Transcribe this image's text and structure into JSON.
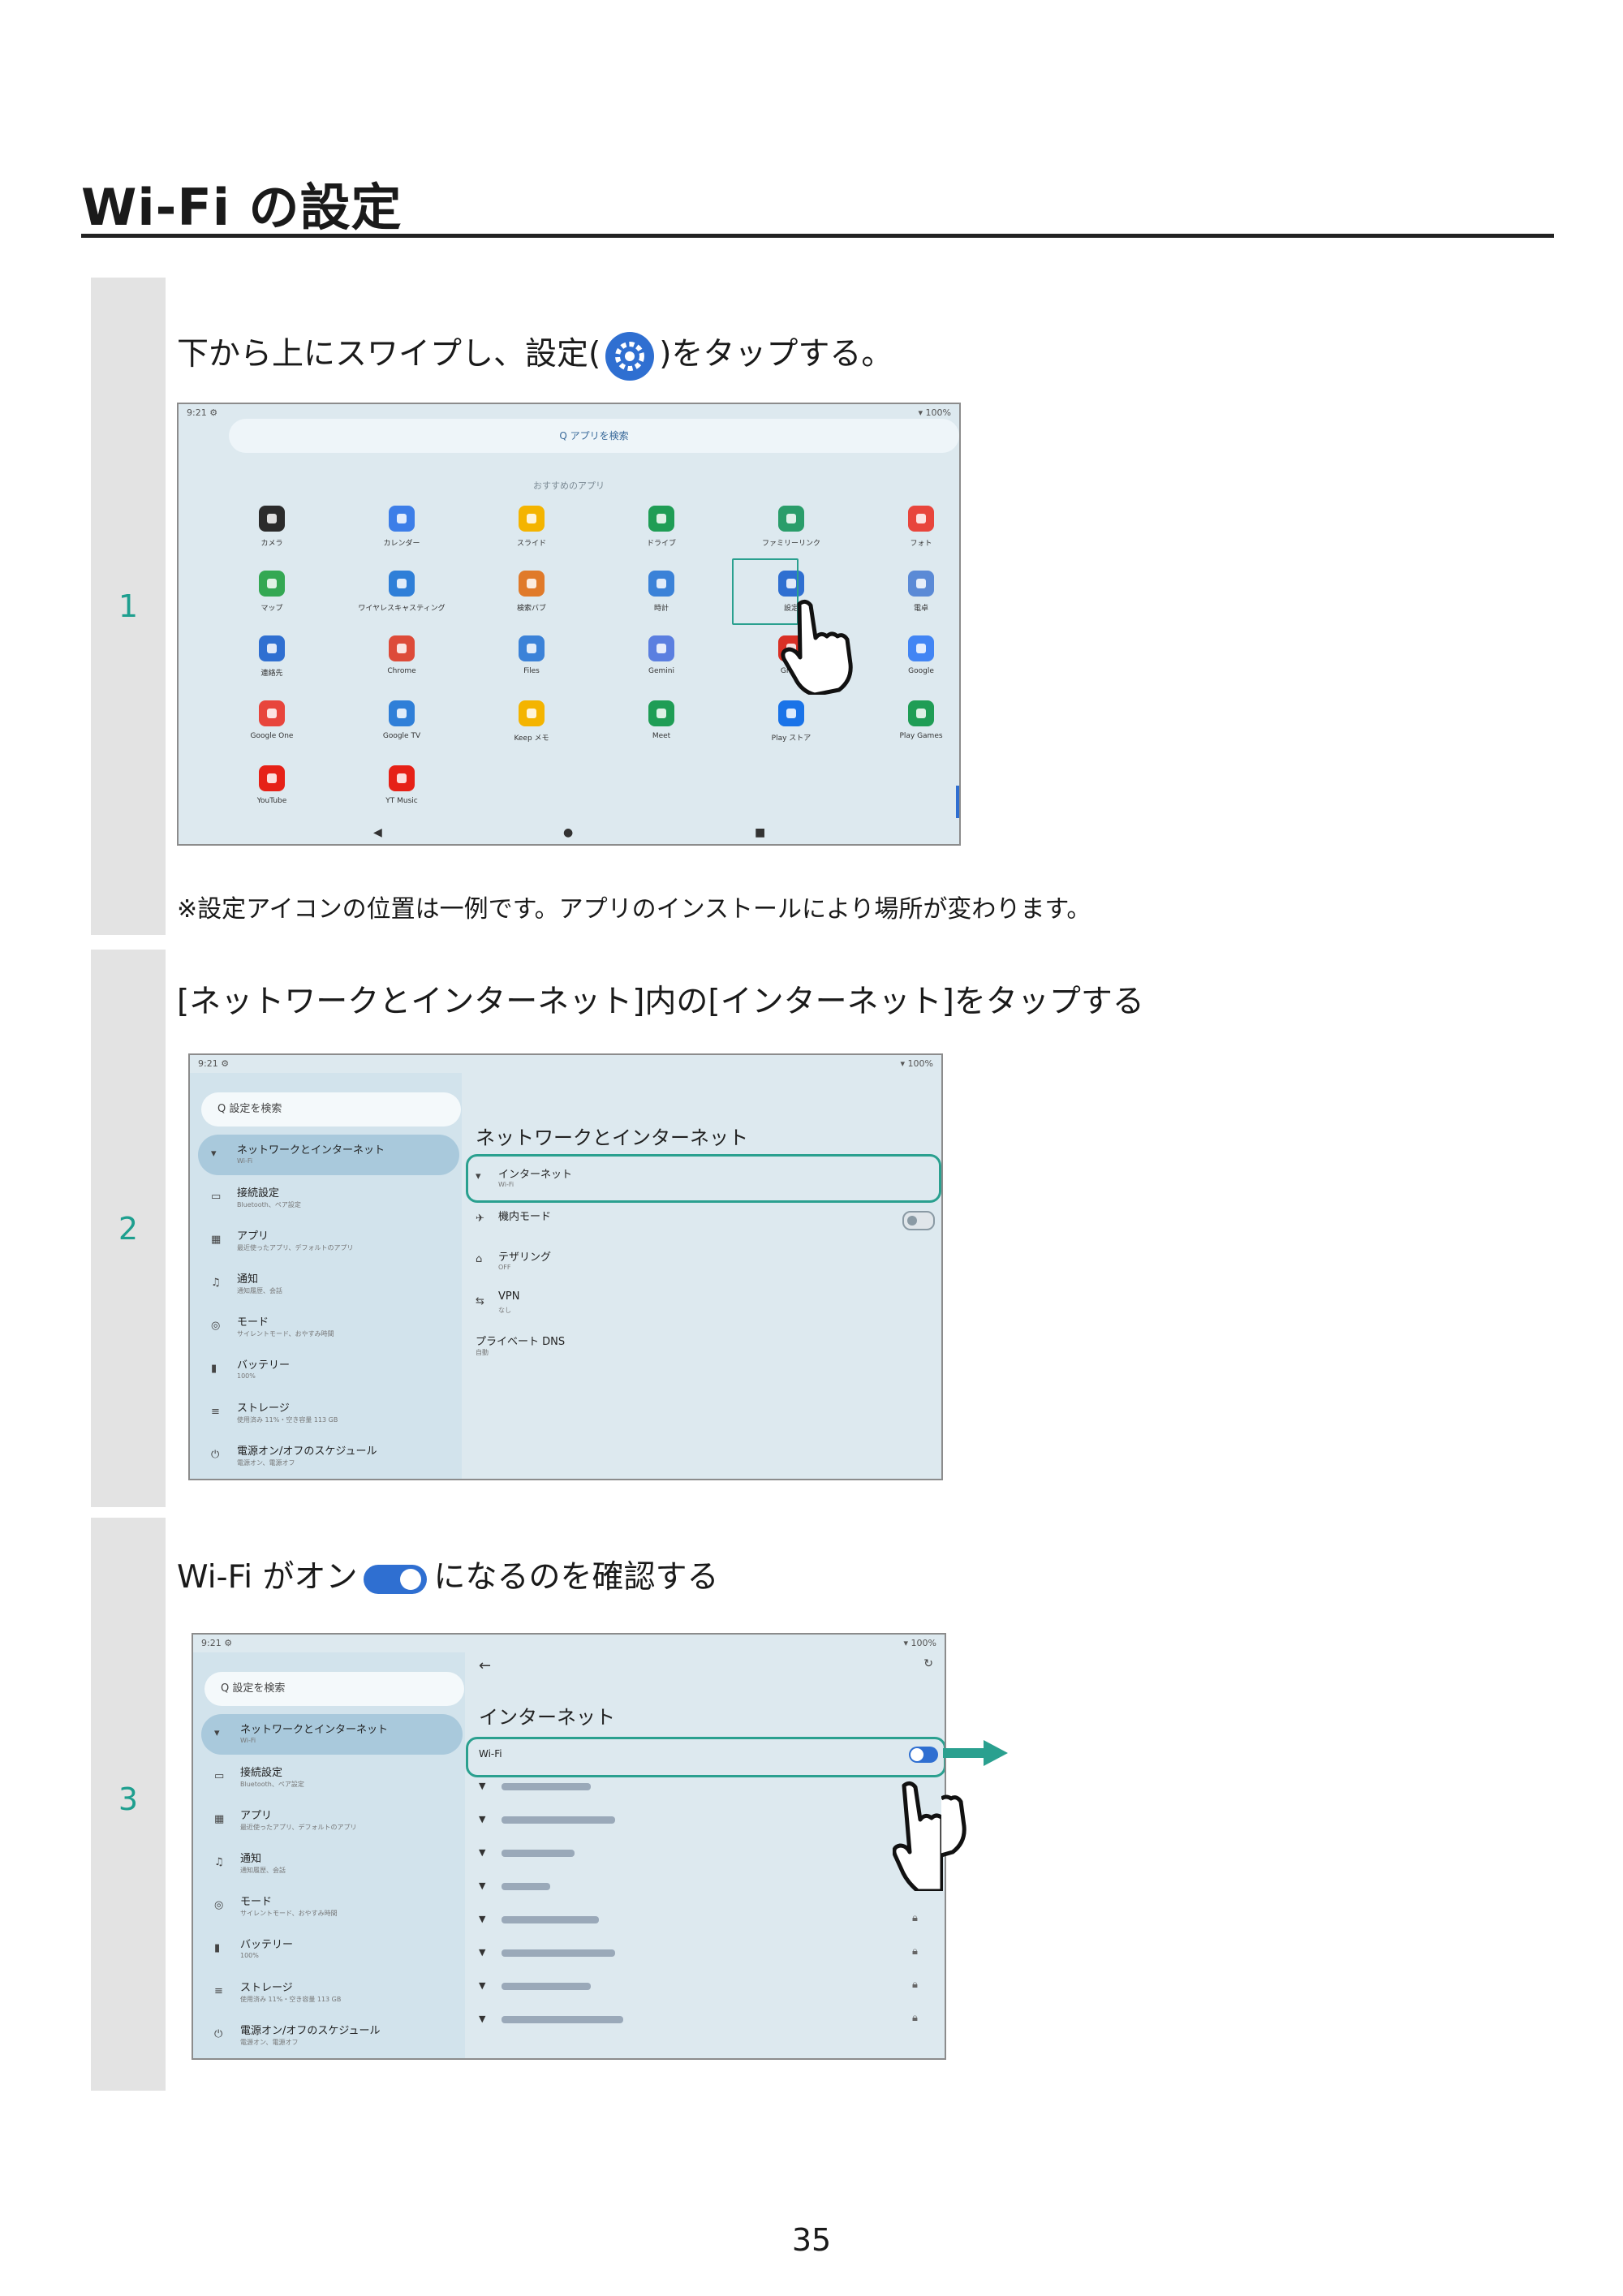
{
  "page": {
    "title": "Wi-Fi の設定",
    "page_number": "35"
  },
  "steps": [
    {
      "number": "1",
      "instruction_before": "下から上にスワイプし、設定(",
      "instruction_icon": "gear-icon",
      "instruction_after": ")をタップする。",
      "note": "※設定アイコンの位置は一例です。アプリのインストールにより場所が変わります。"
    },
    {
      "number": "2",
      "instruction": "[ネットワークとインターネット]内の[インターネット]をタップする"
    },
    {
      "number": "3",
      "instruction_before": "Wi-Fi がオン",
      "instruction_icon": "toggle-on-icon",
      "instruction_after": "になるのを確認する"
    }
  ],
  "home_screen": {
    "status_left": "9:21 ⚙",
    "status_right": "▾ 100%",
    "search_placeholder": "Q アプリを検索",
    "section_label": "おすすめのアプリ",
    "apps": [
      {
        "label": "カメラ",
        "color": "#2b2b2b",
        "icon": "camera-icon"
      },
      {
        "label": "カレンダー",
        "color": "#3d7ee8",
        "icon": "calendar-icon"
      },
      {
        "label": "スライド",
        "color": "#f4b400",
        "icon": "slides-icon"
      },
      {
        "label": "ドライブ",
        "color": "#1f9d55",
        "icon": "drive-icon"
      },
      {
        "label": "ファミリーリンク",
        "color": "#2a9d6a",
        "icon": "family-link-icon"
      },
      {
        "label": "フォト",
        "color": "#e8453c",
        "icon": "photos-icon"
      },
      {
        "label": "マップ",
        "color": "#34a853",
        "icon": "maps-icon"
      },
      {
        "label": "ワイヤレスキャスティング",
        "color": "#2f7fd8",
        "icon": "cast-icon"
      },
      {
        "label": "検索バブ",
        "color": "#e07a2a",
        "icon": "bubble-icon"
      },
      {
        "label": "時計",
        "color": "#3b82d8",
        "icon": "clock-icon"
      },
      {
        "label": "設定",
        "color": "#2f6fd1",
        "icon": "settings-icon"
      },
      {
        "label": "電卓",
        "color": "#5b8ad6",
        "icon": "calculator-icon"
      },
      {
        "label": "連絡先",
        "color": "#2f6fd1",
        "icon": "contacts-icon"
      },
      {
        "label": "Chrome",
        "color": "#dd4b39",
        "icon": "chrome-icon"
      },
      {
        "label": "Files",
        "color": "#3b82d8",
        "icon": "files-icon"
      },
      {
        "label": "Gemini",
        "color": "#5b7fe0",
        "icon": "gemini-icon"
      },
      {
        "label": "Gmail",
        "color": "#d93025",
        "icon": "gmail-icon"
      },
      {
        "label": "Google",
        "color": "#4285f4",
        "icon": "google-icon"
      },
      {
        "label": "Google One",
        "color": "#e8453c",
        "icon": "google-one-icon"
      },
      {
        "label": "Google TV",
        "color": "#2f7fd8",
        "icon": "google-tv-icon"
      },
      {
        "label": "Keep メモ",
        "color": "#f4b400",
        "icon": "keep-icon"
      },
      {
        "label": "Meet",
        "color": "#1f9d55",
        "icon": "meet-icon"
      },
      {
        "label": "Play ストア",
        "color": "#1a73e8",
        "icon": "play-store-icon"
      },
      {
        "label": "Play Games",
        "color": "#1f9d55",
        "icon": "play-games-icon"
      },
      {
        "label": "YouTube",
        "color": "#e62117",
        "icon": "youtube-icon"
      },
      {
        "label": "YT Music",
        "color": "#e62117",
        "icon": "yt-music-icon"
      }
    ]
  },
  "settings_sidebar": {
    "search": "Q 設定を検索",
    "items": [
      {
        "title": "ネットワークとインターネット",
        "subtitle": "Wi-Fi",
        "icon": "wifi-icon"
      },
      {
        "title": "接続設定",
        "subtitle": "Bluetooth、ペア設定",
        "icon": "devices-icon"
      },
      {
        "title": "アプリ",
        "subtitle": "最近使ったアプリ、デフォルトのアプリ",
        "icon": "apps-icon"
      },
      {
        "title": "通知",
        "subtitle": "通知履歴、会話",
        "icon": "bell-icon"
      },
      {
        "title": "モード",
        "subtitle": "サイレントモード、おやすみ時間",
        "icon": "mode-icon"
      },
      {
        "title": "バッテリー",
        "subtitle": "100%",
        "icon": "battery-icon"
      },
      {
        "title": "ストレージ",
        "subtitle": "使用済み 11%・空き容量 113 GB",
        "icon": "storage-icon"
      },
      {
        "title": "電源オン/オフのスケジュール",
        "subtitle": "電源オン、電源オフ",
        "icon": "power-icon"
      }
    ]
  },
  "network_panel": {
    "title": "ネットワークとインターネット",
    "rows": [
      {
        "title": "インターネット",
        "subtitle": "Wi-Fi",
        "icon": "wifi-icon"
      },
      {
        "title": "機内モード",
        "subtitle": "",
        "icon": "airplane-icon"
      },
      {
        "title": "テザリング",
        "subtitle": "OFF",
        "icon": "hotspot-icon"
      },
      {
        "title": "VPN",
        "subtitle": "なし",
        "icon": "vpn-icon"
      },
      {
        "title": "プライベート DNS",
        "subtitle": "自動",
        "icon": ""
      }
    ]
  },
  "internet_panel": {
    "back": "←",
    "title": "インターネット",
    "wifi_label": "Wi-Fi",
    "wifi_on": true
  },
  "colors": {
    "accent": "#2aa08f",
    "step_bar": "#e3e3e3",
    "step_number": "#1e9f8f",
    "screen_bg": "#dde9ef",
    "toggle_on": "#2f6fd1"
  }
}
